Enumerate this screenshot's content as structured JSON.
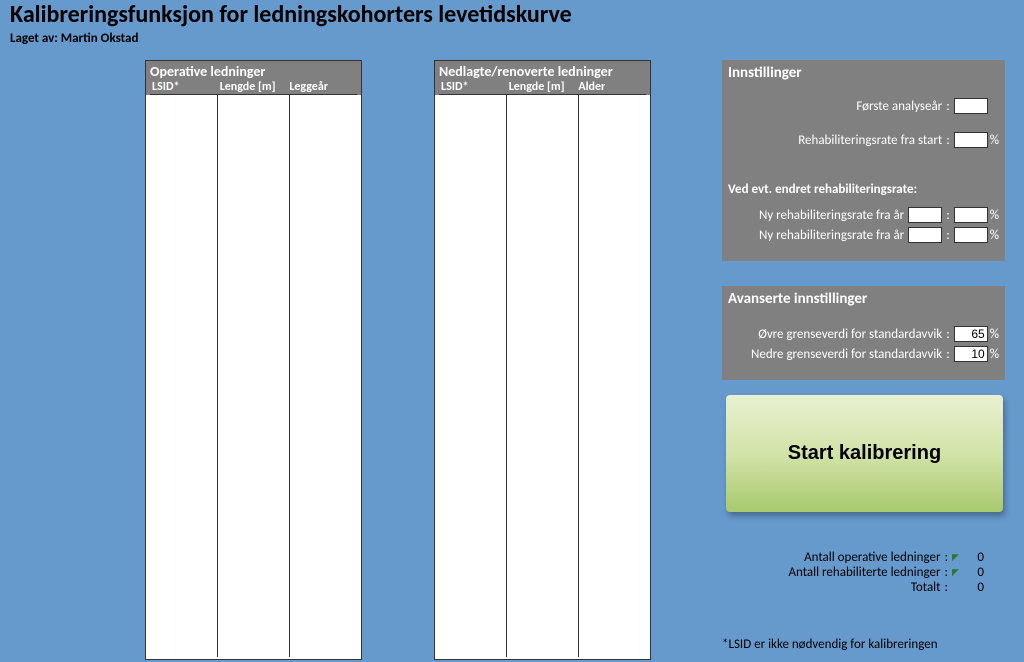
{
  "header": {
    "title": "Kalibreringsfunksjon for ledningskohorters levetidskurve",
    "subtitle_prefix": "Laget av:  ",
    "author": "Martin Okstad"
  },
  "tables": {
    "operative": {
      "title": "Operative ledninger",
      "cols": [
        "LSID*",
        "Lengde [m]",
        "Leggeår"
      ]
    },
    "nedlagte": {
      "title": "Nedlagte/renoverte ledninger",
      "cols": [
        "LSID*",
        "Lengde [m]",
        "Alder"
      ]
    }
  },
  "settings": {
    "title": "Innstillinger",
    "first_year_label": "Første analyseår",
    "first_year_value": "",
    "rehab_start_label": "Rehabiliteringsrate fra start",
    "rehab_start_value": "",
    "changed_heading": "Ved evt. endret rehabiliteringsrate:",
    "new_rate1_label": "Ny rehabiliteringsrate fra år",
    "new_rate1_year": "",
    "new_rate1_value": "",
    "new_rate2_label": "Ny rehabiliteringsrate fra år",
    "new_rate2_year": "",
    "new_rate2_value": ""
  },
  "advanced": {
    "title": "Avanserte innstillinger",
    "upper_label": "Øvre grenseverdi for standardavvik",
    "upper_value": "65",
    "lower_label": "Nedre grenseverdi for standardavvik",
    "lower_value": "10"
  },
  "button": {
    "start_label": "Start kalibrering"
  },
  "stats": {
    "operative_label": "Antall operative ledninger",
    "operative_value": "0",
    "rehab_label": "Antall rehabiliterte ledninger",
    "rehab_value": "0",
    "total_label": "Totalt",
    "total_value": "0"
  },
  "footnote": "*LSID er ikke nødvendig for kalibreringen",
  "symbols": {
    "pct": "%",
    "colon": ":"
  }
}
